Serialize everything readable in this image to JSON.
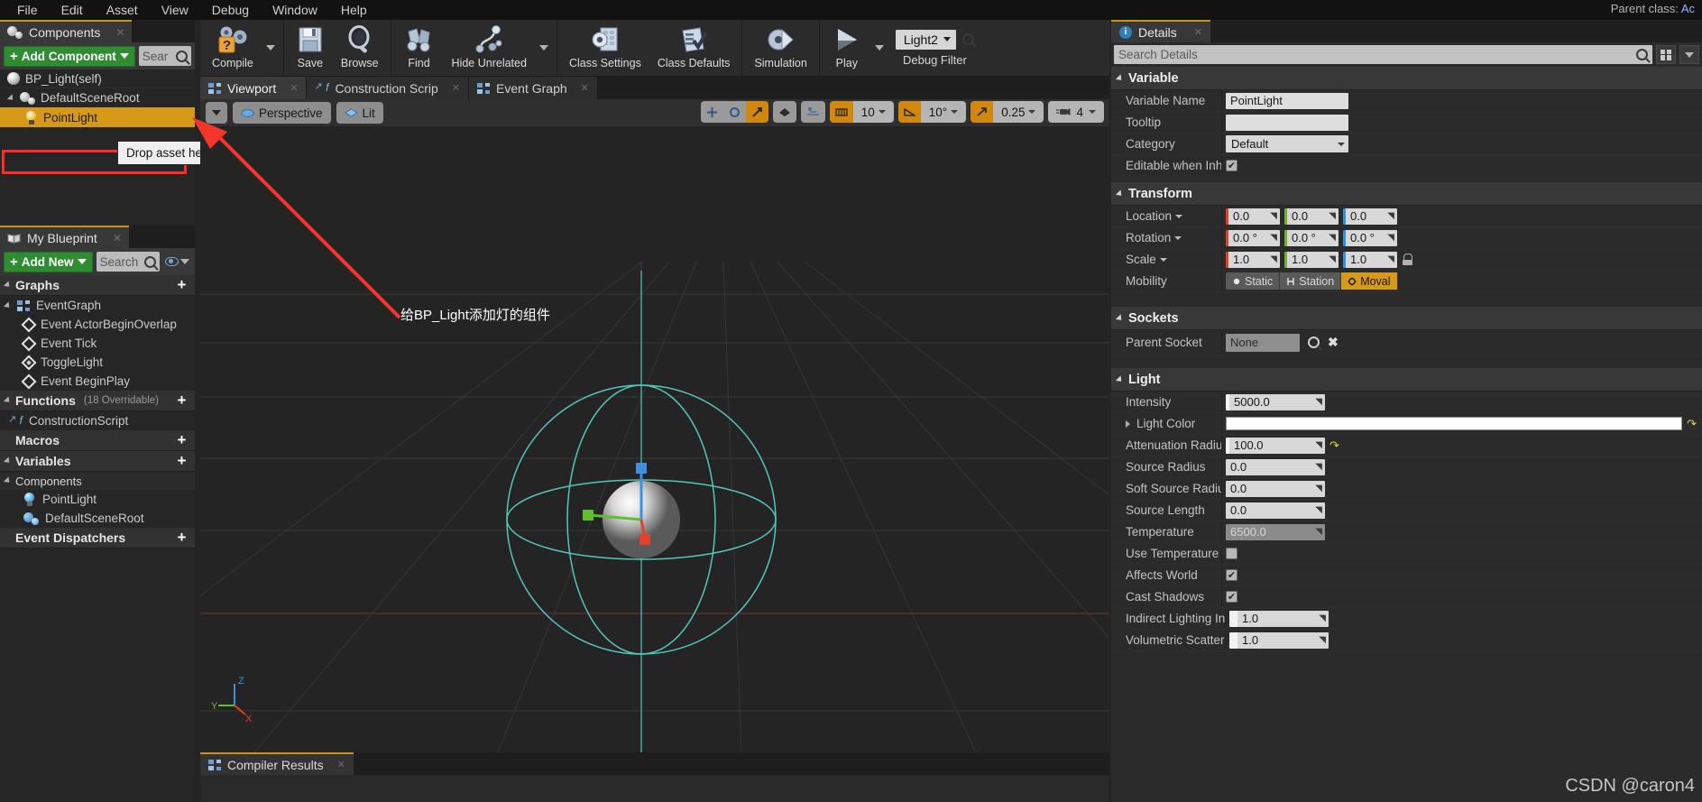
{
  "menu": {
    "items": [
      "File",
      "Edit",
      "Asset",
      "View",
      "Debug",
      "Window",
      "Help"
    ],
    "parent_class_label": "Parent class:",
    "parent_class_value": "Ac"
  },
  "toolbar": {
    "buttons": [
      {
        "label": "Compile",
        "icon": "compile-gear-question-icon",
        "has_dropdown": true
      },
      {
        "label": "Save",
        "icon": "floppy-disk-icon",
        "has_dropdown": false
      },
      {
        "label": "Browse",
        "icon": "magnifier-browse-icon",
        "has_dropdown": false
      },
      {
        "label": "Find",
        "icon": "binoculars-icon",
        "has_dropdown": false
      },
      {
        "label": "Hide Unrelated",
        "icon": "node-graph-icon",
        "has_dropdown": true
      },
      {
        "label": "Class Settings",
        "icon": "class-settings-gear-icon",
        "has_dropdown": false
      },
      {
        "label": "Class Defaults",
        "icon": "class-defaults-checklist-icon",
        "has_dropdown": false
      },
      {
        "label": "Simulation",
        "icon": "simulation-gear-icon",
        "has_dropdown": false
      },
      {
        "label": "Play",
        "icon": "play-triangle-icon",
        "has_dropdown": true
      }
    ],
    "debug_filter_value": "Light2",
    "debug_filter_label": "Debug Filter"
  },
  "components_panel": {
    "tab_title": "Components",
    "add_component_label": "Add Component",
    "search_placeholder": "Sear",
    "tree": [
      {
        "label": "BP_Light(self)",
        "icon": "sphere-icon",
        "indent": 0,
        "selected": false
      },
      {
        "label": "DefaultSceneRoot",
        "icon": "dual-sphere-icon",
        "indent": 1,
        "selected": false
      },
      {
        "label": "PointLight",
        "icon": "light-bulb-icon",
        "indent": 2,
        "selected": true
      }
    ],
    "drop_hint": "Drop asset here to add a component."
  },
  "my_blueprint": {
    "tab_title": "My Blueprint",
    "add_new_label": "Add New",
    "search_placeholder": "Search",
    "sections": [
      {
        "title": "Graphs",
        "sub": "",
        "items": [
          {
            "label": "EventGraph",
            "icon": "graph-icon",
            "indent": 0
          },
          {
            "label": "Event ActorBeginOverlap",
            "icon": "event-diamond-icon",
            "indent": 1
          },
          {
            "label": "Event Tick",
            "icon": "event-diamond-icon",
            "indent": 1
          },
          {
            "label": "ToggleLight",
            "icon": "custom-event-diamond-icon",
            "indent": 1
          },
          {
            "label": "Event BeginPlay",
            "icon": "event-diamond-icon",
            "indent": 1
          }
        ]
      },
      {
        "title": "Functions",
        "sub": "(18 Overridable)",
        "items": [
          {
            "label": "ConstructionScript",
            "icon": "function-icon",
            "indent": 0
          }
        ]
      },
      {
        "title": "Macros",
        "sub": "",
        "items": []
      },
      {
        "title": "Variables",
        "sub": "",
        "items": []
      }
    ],
    "variables_group": {
      "title": "Components",
      "items": [
        {
          "label": "PointLight",
          "icon": "light-bulb-blue-icon"
        },
        {
          "label": "DefaultSceneRoot",
          "icon": "dual-sphere-blue-icon"
        }
      ]
    },
    "event_dispatchers_title": "Event Dispatchers"
  },
  "center": {
    "tabs": [
      {
        "label": "Viewport",
        "icon": "viewport-grid-icon",
        "active": true
      },
      {
        "label": "Construction Scrip",
        "icon": "function-italic-icon",
        "active": false
      },
      {
        "label": "Event Graph",
        "icon": "graph-icon",
        "active": false
      }
    ],
    "viewport_toolbar": {
      "view_menu_icon": "chevron-down-icon",
      "perspective_label": "Perspective",
      "lit_label": "Lit",
      "snap_angle": "10",
      "rotation_snap": "10°",
      "scale_snap": "0.25",
      "camera_speed": "4"
    },
    "annotation": "给BP_Light添加灯的组件",
    "axis_labels": {
      "x": "X",
      "y": "Y",
      "z": "Z"
    },
    "compiler_results_tab": "Compiler Results"
  },
  "details": {
    "tab_title": "Details",
    "search_placeholder": "Search Details",
    "sections": [
      {
        "title": "Variable",
        "rows": [
          {
            "label": "Variable Name",
            "type": "text",
            "value": "PointLight"
          },
          {
            "label": "Tooltip",
            "type": "text",
            "value": ""
          },
          {
            "label": "Category",
            "type": "combo",
            "value": "Default"
          },
          {
            "label": "Editable when Inherite",
            "type": "checkbox",
            "value": true
          }
        ]
      },
      {
        "title": "Transform",
        "rows": [
          {
            "label": "Location",
            "type": "vector",
            "dropdown": true,
            "values": [
              "0.0",
              "0.0",
              "0.0"
            ]
          },
          {
            "label": "Rotation",
            "type": "vector",
            "dropdown": true,
            "values": [
              "0.0 °",
              "0.0 °",
              "0.0 °"
            ]
          },
          {
            "label": "Scale",
            "type": "vector",
            "dropdown": true,
            "values": [
              "1.0",
              "1.0",
              "1.0"
            ],
            "lock": true
          },
          {
            "label": "Mobility",
            "type": "mobility",
            "options": [
              "Static",
              "Station",
              "Moval"
            ],
            "selected": 2
          }
        ]
      },
      {
        "title": "Sockets",
        "rows": [
          {
            "label": "Parent Socket",
            "type": "socket",
            "value": "None"
          }
        ]
      },
      {
        "title": "Light",
        "rows": [
          {
            "label": "Intensity",
            "type": "num",
            "value": "5000.0"
          },
          {
            "label": "Light Color",
            "type": "color",
            "value": "#ffffff",
            "expandable": true,
            "revert": true
          },
          {
            "label": "Attenuation Radius",
            "type": "num",
            "value": "100.0",
            "revert": true
          },
          {
            "label": "Source Radius",
            "type": "num",
            "value": "0.0"
          },
          {
            "label": "Soft Source Radius",
            "type": "num",
            "value": "0.0"
          },
          {
            "label": "Source Length",
            "type": "num",
            "value": "0.0"
          },
          {
            "label": "Temperature",
            "type": "num-disabled",
            "value": "6500.0"
          },
          {
            "label": "Use Temperature",
            "type": "checkbox",
            "value": false
          },
          {
            "label": "Affects World",
            "type": "checkbox",
            "value": true
          },
          {
            "label": "Cast Shadows",
            "type": "checkbox",
            "value": true
          },
          {
            "label": "Indirect Lighting Inten",
            "type": "slider",
            "value": "1.0"
          },
          {
            "label": "Volumetric Scattering",
            "type": "slider",
            "value": "1.0"
          }
        ]
      }
    ]
  },
  "watermark": "CSDN @caron4",
  "colors": {
    "accent_orange": "#d79a18",
    "tab_accent": "#c8921e",
    "green_button": "#2f8c33",
    "highlight_red": "#ff2b2b",
    "viewport_wire": "#55c5bd"
  }
}
